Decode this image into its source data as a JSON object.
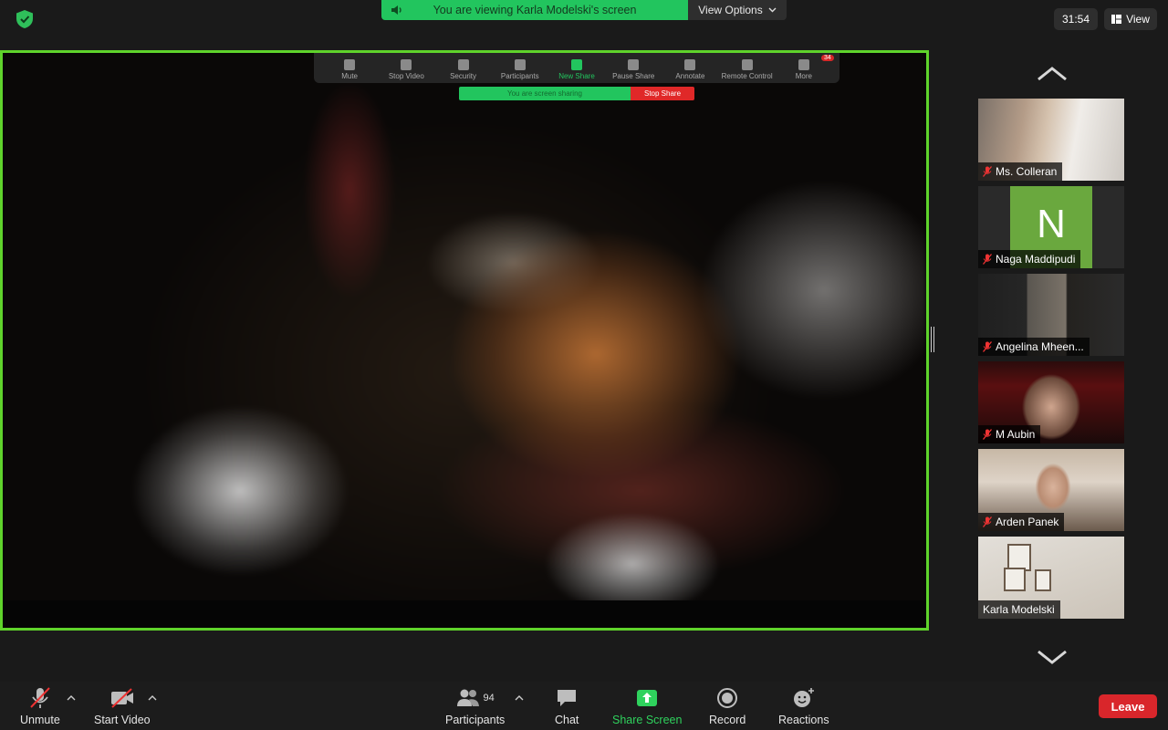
{
  "top_bar": {
    "share_banner_text": "You are viewing Karla Modelski's screen",
    "view_options_label": "View Options",
    "timer": "31:54",
    "view_label": "View"
  },
  "shared_screen": {
    "inner_toolbar": {
      "items": [
        "Mute",
        "Stop Video",
        "Security",
        "Participants",
        "New Share",
        "Pause Share",
        "Annotate",
        "Remote Control",
        "More"
      ],
      "participants_count": "94",
      "more_badge": "34"
    },
    "sharing_text": "You are screen sharing",
    "stop_share_label": "Stop Share"
  },
  "gallery": {
    "participants": [
      {
        "name": "Ms. Colleran",
        "muted": true
      },
      {
        "name": "Naga Maddipudi",
        "muted": true,
        "avatar_letter": "N"
      },
      {
        "name": "Angelina Mheen...",
        "muted": true
      },
      {
        "name": "M Aubin",
        "muted": true
      },
      {
        "name": "Arden Panek",
        "muted": true
      },
      {
        "name": "Karla Modelski",
        "muted": false
      }
    ]
  },
  "toolbar": {
    "unmute_label": "Unmute",
    "start_video_label": "Start Video",
    "participants_label": "Participants",
    "participants_count": "94",
    "chat_label": "Chat",
    "share_screen_label": "Share Screen",
    "record_label": "Record",
    "reactions_label": "Reactions",
    "leave_label": "Leave"
  },
  "colors": {
    "share_border": "#5fd32b",
    "banner_green": "#22c55e",
    "leave_red": "#d9262b"
  }
}
